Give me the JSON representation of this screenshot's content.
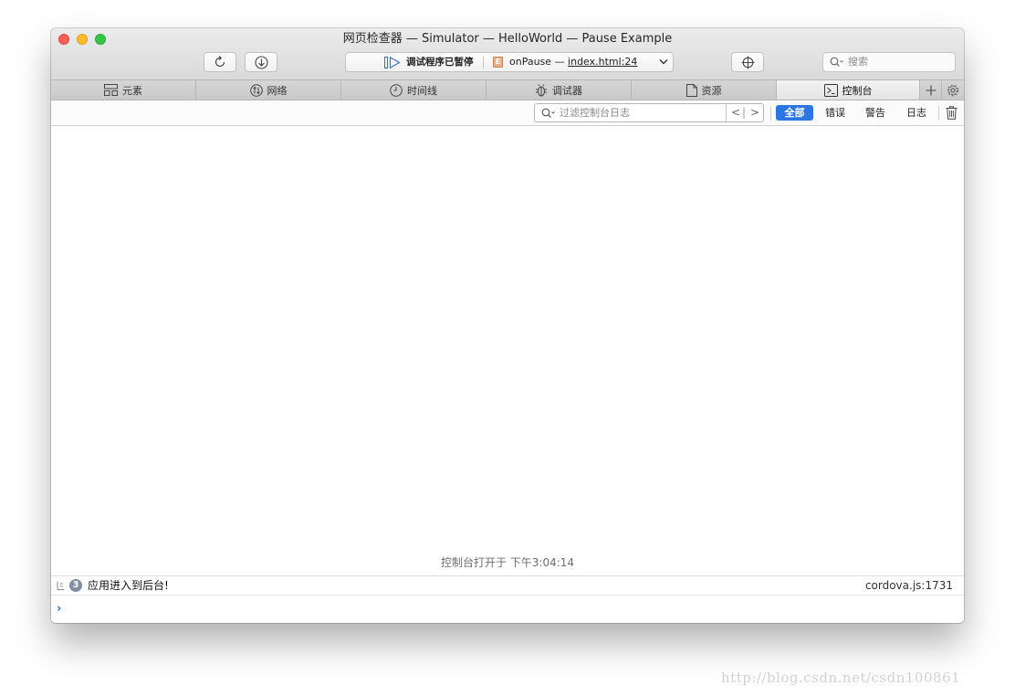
{
  "window": {
    "title": "网页检查器 — Simulator — HelloWorld — Pause Example"
  },
  "toolbar": {
    "reload_icon": "reload-icon",
    "download_icon": "download-icon",
    "debugger_status": "调试程序已暂停",
    "pause_function": "onPause — ",
    "pause_location": "index.html:24",
    "target_icon": "crosshair-icon",
    "search_placeholder": "搜索"
  },
  "tabs": [
    {
      "label": "元素",
      "icon": "elements-icon",
      "active": false
    },
    {
      "label": "网络",
      "icon": "network-icon",
      "active": false
    },
    {
      "label": "时间线",
      "icon": "timeline-icon",
      "active": false
    },
    {
      "label": "调试器",
      "icon": "debugger-icon",
      "active": false
    },
    {
      "label": "资源",
      "icon": "resources-icon",
      "active": false
    },
    {
      "label": "控制台",
      "icon": "console-icon",
      "active": true
    }
  ],
  "filter": {
    "placeholder": "过滤控制台日志",
    "prev": "<",
    "next": ">",
    "scopes": [
      "全部",
      "错误",
      "警告",
      "日志"
    ],
    "active_scope": "全部"
  },
  "console": {
    "session_started": "控制台打开于 下午3:04:14",
    "messages": [
      {
        "count": "3",
        "text": "应用进入到后台!",
        "source": "cordova.js:1731"
      }
    ],
    "prompt": "›"
  },
  "colors": {
    "accent": "#2b75e5",
    "close": "#fc5f57",
    "minimize": "#fdbc2e",
    "maximize": "#33c748"
  },
  "watermark": "http://blog.csdn.net/csdn100861"
}
